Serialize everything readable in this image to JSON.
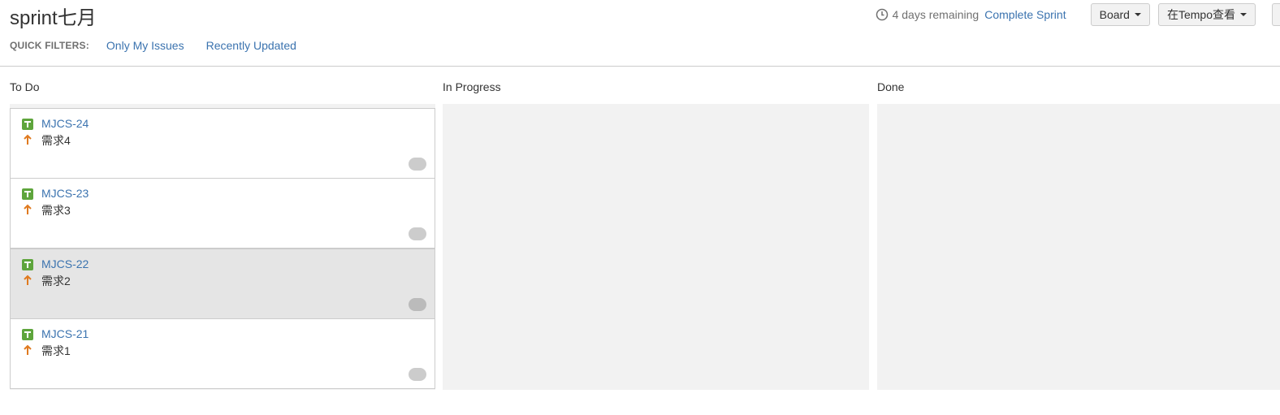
{
  "sprint": {
    "title": "sprint七月"
  },
  "quick_filters": {
    "label": "QUICK FILTERS:",
    "items": [
      {
        "label": "Only My Issues"
      },
      {
        "label": "Recently Updated"
      }
    ]
  },
  "header_actions": {
    "clock_icon": "clock-icon",
    "remaining": "4 days remaining",
    "complete_sprint": "Complete Sprint",
    "board_button": "Board",
    "tempo_button": "在Tempo查看"
  },
  "columns": [
    {
      "name": "To Do"
    },
    {
      "name": "In Progress"
    },
    {
      "name": "Done"
    }
  ],
  "cards": [
    {
      "key": "MJCS-24",
      "summary": "需求4",
      "type_icon": "story-icon",
      "priority_icon": "priority-major-icon",
      "selected": false
    },
    {
      "key": "MJCS-23",
      "summary": "需求3",
      "type_icon": "story-icon",
      "priority_icon": "priority-major-icon",
      "selected": false
    },
    {
      "key": "MJCS-22",
      "summary": "需求2",
      "type_icon": "story-icon",
      "priority_icon": "priority-major-icon",
      "selected": true
    },
    {
      "key": "MJCS-21",
      "summary": "需求1",
      "type_icon": "story-icon",
      "priority_icon": "priority-major-icon",
      "selected": false
    }
  ],
  "colors": {
    "link": "#3b73af",
    "story": "#5ea53c",
    "priority_major": "#e07a1f",
    "column_bg": "#f2f2f2",
    "selected_card_bg": "#e5e5e5"
  }
}
